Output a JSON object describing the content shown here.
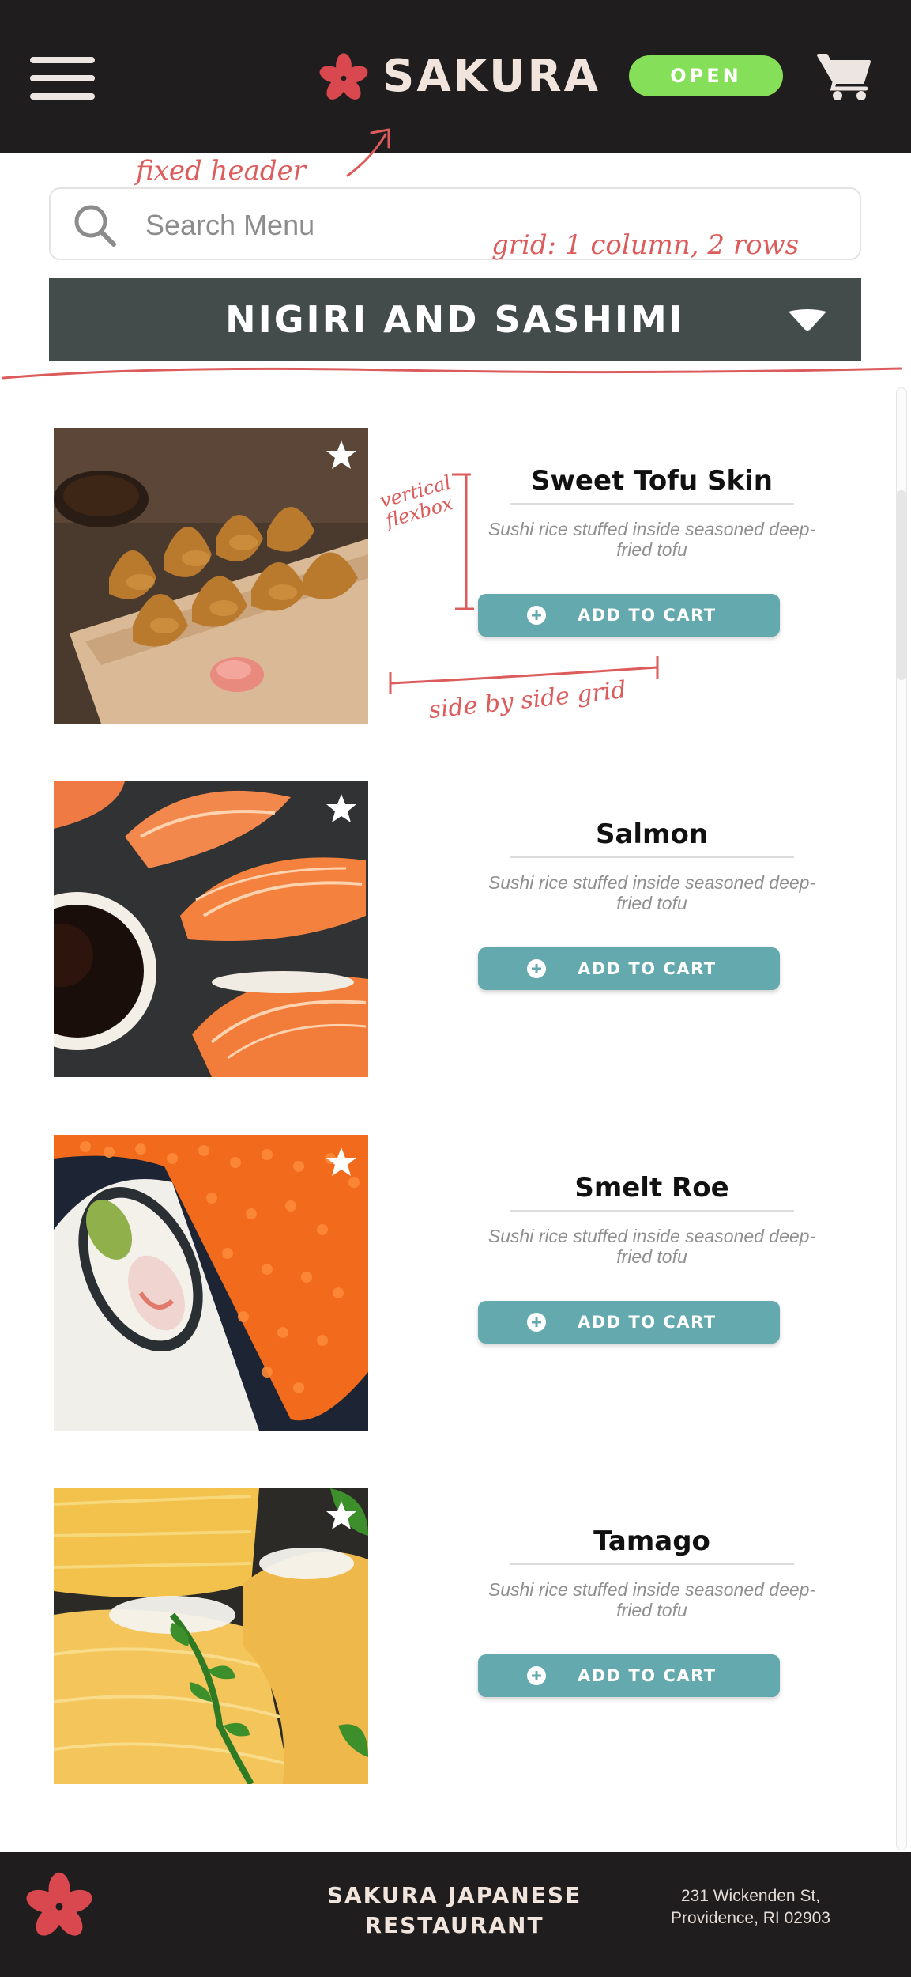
{
  "header": {
    "brand": "SAKURA",
    "status_badge": "OPEN",
    "colors": {
      "background": "#1f1d1d",
      "brand_text": "#f0e4dd",
      "accent": "#d9484f",
      "open": "#86df59"
    }
  },
  "search": {
    "placeholder": "Search Menu",
    "value": ""
  },
  "category": {
    "title": "NIGIRI AND SASHIMI"
  },
  "menu_items": [
    {
      "name": "Sweet Tofu Skin",
      "description": "Sushi rice stuffed inside seasoned deep-fried tofu",
      "button": "ADD TO CART",
      "image": "inari-tofu-pockets"
    },
    {
      "name": "Salmon",
      "description": "Sushi rice stuffed inside seasoned deep-fried tofu",
      "button": "ADD TO CART",
      "image": "salmon-nigiri"
    },
    {
      "name": "Smelt Roe",
      "description": "Sushi rice stuffed inside seasoned deep-fried tofu",
      "button": "ADD TO CART",
      "image": "smelt-roe-roll"
    },
    {
      "name": "Tamago",
      "description": "Sushi rice stuffed inside seasoned deep-fried tofu",
      "button": "ADD TO CART",
      "image": "tamago-omelette"
    }
  ],
  "footer": {
    "restaurant_name": "SAKURA JAPANESE RESTAURANT",
    "address_line1": "231 Wickenden St,",
    "address_line2": "Providence, RI 02903"
  },
  "annotations": {
    "fixed_header": "fixed header",
    "grid": "grid: 1 column, 2 rows",
    "vertical_flexbox": "vertical flexbox",
    "side_by_side_grid": "side by side grid",
    "color": "#dc5b5b"
  },
  "icons": [
    "hamburger-menu-icon",
    "sakura-flower-icon",
    "cart-icon",
    "search-icon",
    "chevron-down-icon",
    "star-icon",
    "plus-circle-icon"
  ],
  "button_color": "#64a9ad"
}
